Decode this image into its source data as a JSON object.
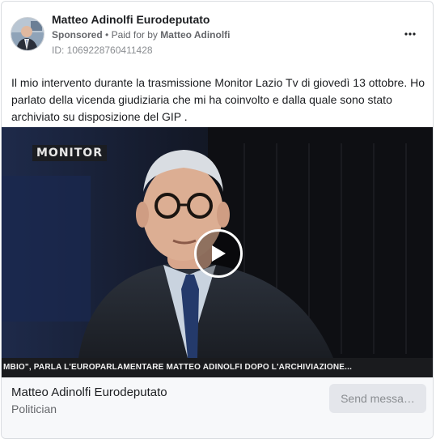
{
  "ad": {
    "page_name": "Matteo Adinolfi Eurodeputato",
    "sponsored_label": "Sponsored",
    "separator": "•",
    "paid_for_label": "Paid for by",
    "payer": "Matteo Adinolfi",
    "ad_id": "ID: 1069228760411428",
    "more_icon": "more-horizontal-icon",
    "body_text": "Il mio intervento durante la trasmissione Monitor Lazio Tv di giovedì 13 ottobre. Ho parlato della vicenda giudiziaria che mi ha coinvolto e dalla quale sono stato archiviato su disposizione del GIP ."
  },
  "video": {
    "logo_text": "MONITOR",
    "ticker_text": "MBIO\", PARLA  L'EUROPARLAMENTARE MATTEO ADINOLFI DOPO L'ARCHIVIAZIONE...",
    "play_icon": "play-icon"
  },
  "footer": {
    "page_name": "Matteo Adinolfi Eurodeputato",
    "category": "Politician",
    "cta_label": "Send messa…"
  },
  "colors": {
    "text_primary": "#1c1e21",
    "text_secondary": "#65676b",
    "button_bg": "#e4e6eb",
    "ticker_bg": "#1a1b1e"
  }
}
